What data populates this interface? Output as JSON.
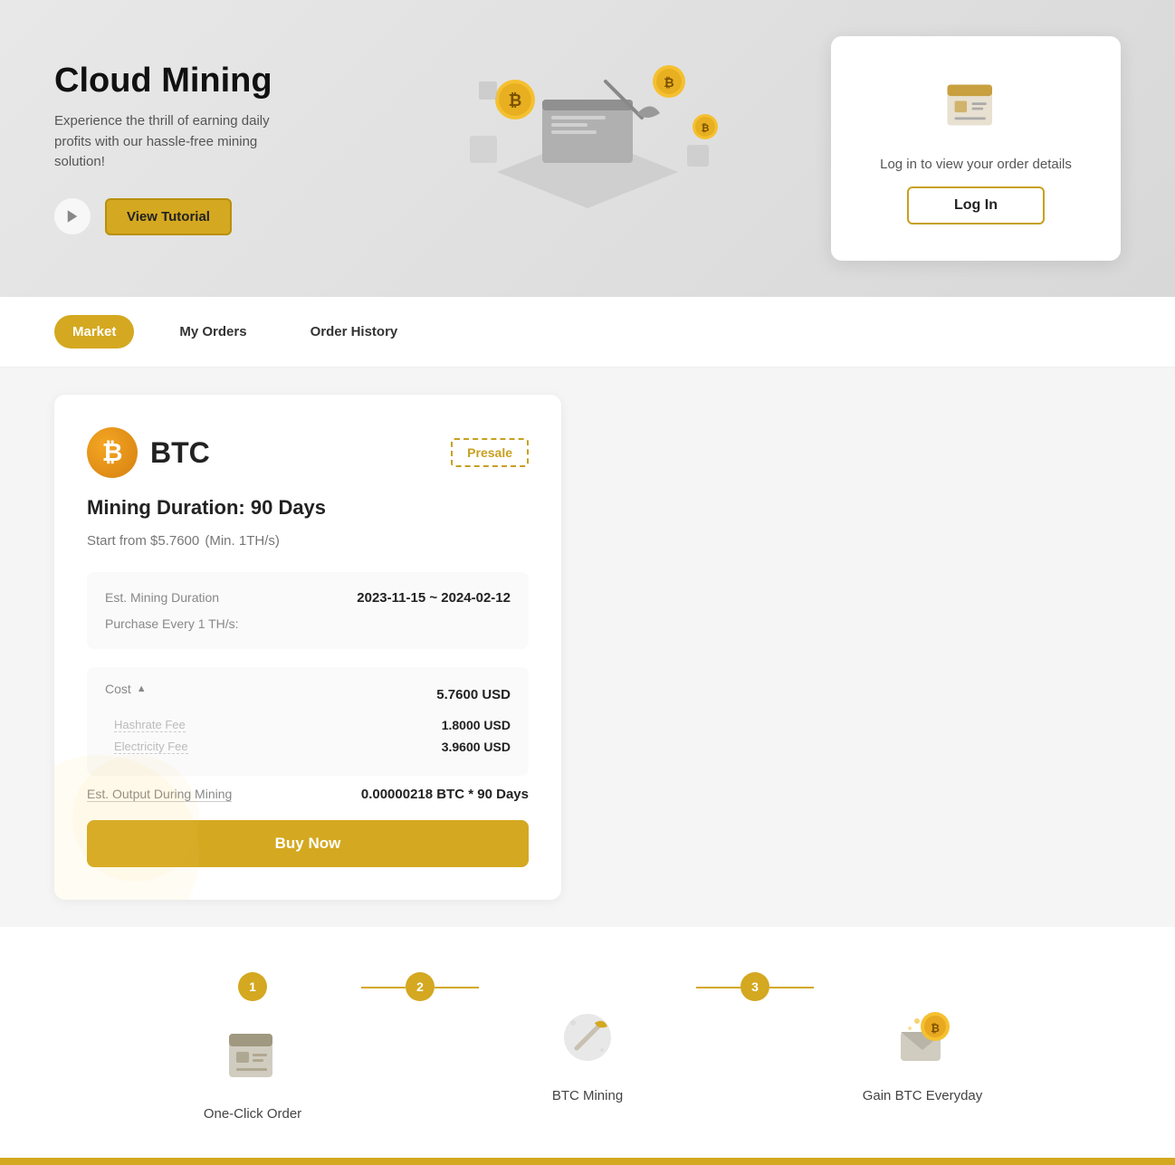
{
  "hero": {
    "title": "Cloud Mining",
    "subtitle": "Experience the thrill of earning daily profits with our hassle-free mining solution!",
    "tutorial_label": "View Tutorial",
    "play_icon": "▶"
  },
  "login_card": {
    "text": "Log in to view your order details",
    "button_label": "Log In"
  },
  "tabs": [
    {
      "id": "market",
      "label": "Market",
      "active": true
    },
    {
      "id": "my-orders",
      "label": "My Orders",
      "active": false
    },
    {
      "id": "order-history",
      "label": "Order History",
      "active": false
    }
  ],
  "mining_card": {
    "coin": "BTC",
    "coin_symbol": "₿",
    "presale_label": "Presale",
    "duration_label": "Mining Duration: 90 Days",
    "price_label": "Start from $5.7600",
    "price_note": "(Min. 1TH/s)",
    "details": {
      "est_mining_duration_label": "Est. Mining Duration",
      "est_mining_duration_value": "2023-11-15 ~ 2024-02-12",
      "purchase_label": "Purchase Every 1 TH/s:",
      "cost_label": "Cost",
      "cost_total": "5.7600 USD",
      "hashrate_fee_label": "Hashrate Fee",
      "hashrate_fee_value": "1.8000 USD",
      "electricity_fee_label": "Electricity Fee",
      "electricity_fee_value": "3.9600 USD",
      "output_label": "Est. Output During Mining",
      "output_value": "0.00000218 BTC * 90 Days"
    },
    "buy_label": "Buy Now"
  },
  "steps": [
    {
      "num": "1",
      "label": "One-Click Order"
    },
    {
      "num": "2",
      "label": "BTC Mining"
    },
    {
      "num": "3",
      "label": "Gain BTC Everyday"
    }
  ]
}
